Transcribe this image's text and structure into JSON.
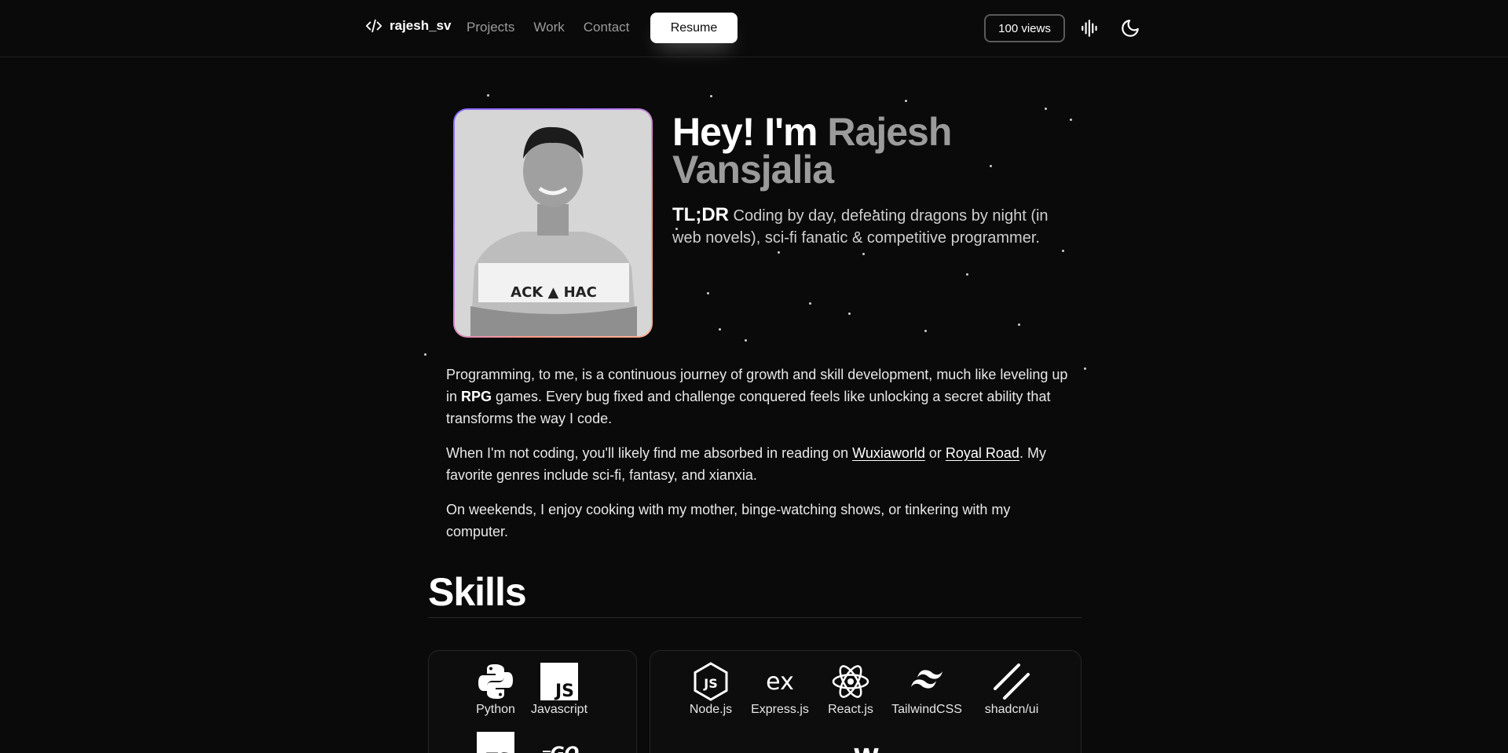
{
  "header": {
    "brand_name": "rajesh_sv",
    "nav": [
      "Projects",
      "Work",
      "Contact"
    ],
    "resume_label": "Resume",
    "views_label": "100 views"
  },
  "hero": {
    "greeting": "Hey! I'm ",
    "name": "Rajesh Vansjalia",
    "tldr_label": "TL;DR",
    "tldr_text": " Coding by day, defeating dragons by night (in web novels), sci-fi fanatic & competitive programmer."
  },
  "about": {
    "p1_a": "Programming, to me, is a continuous journey of growth and skill development, much like leveling up in ",
    "p1_b": "RPG",
    "p1_c": " games. Every bug fixed and challenge conquered feels like unlocking a secret ability that transforms the way I code.",
    "p2_a": "When I'm not coding, you'll likely find me absorbed in reading on ",
    "p2_link1": "Wuxiaworld",
    "p2_b": " or ",
    "p2_link2": "Royal Road",
    "p2_c": ". My favorite genres include sci-fi, fantasy, and xianxia.",
    "p3": "On weekends, I enjoy cooking with my mother, binge-watching shows, or tinkering with my computer."
  },
  "skills": {
    "title": "Skills",
    "languages": [
      {
        "label": "Python",
        "icon": "python-icon"
      },
      {
        "label": "Javascript",
        "icon": "javascript-icon"
      }
    ],
    "frameworks": [
      {
        "label": "Node.js",
        "icon": "nodejs-icon"
      },
      {
        "label": "Express.js",
        "icon": "expressjs-icon"
      },
      {
        "label": "React.js",
        "icon": "react-icon"
      },
      {
        "label": "TailwindCSS",
        "icon": "tailwind-icon"
      },
      {
        "label": "shadcn/ui",
        "icon": "shadcn-icon"
      }
    ],
    "partial_icons": {
      "typescript": "TS",
      "go": "GO",
      "webflow": "W"
    }
  },
  "colors": {
    "background": "#0a0a0a",
    "accent": "#ffffff",
    "muted": "#9b9b9b",
    "avatar_gradient_start": "#8b6bff",
    "avatar_gradient_end": "#ffb199"
  }
}
